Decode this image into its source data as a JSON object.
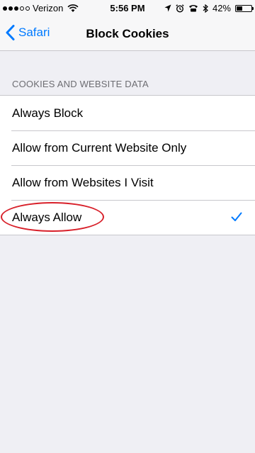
{
  "status_bar": {
    "signal_bars_filled": 3,
    "signal_bars_total": 5,
    "carrier": "Verizon",
    "time": "5:56 PM",
    "battery_percent": "42%",
    "battery_level": 0.42,
    "icons": [
      "wifi-icon",
      "location-arrow-icon",
      "alarm-icon",
      "phone-icon",
      "bluetooth-icon",
      "battery-icon"
    ]
  },
  "nav": {
    "back_label": "Safari",
    "title": "Block Cookies",
    "accent_color": "#007aff"
  },
  "section": {
    "header": "COOKIES AND WEBSITE DATA",
    "options": [
      {
        "label": "Always Block",
        "selected": false
      },
      {
        "label": "Allow from Current Website Only",
        "selected": false
      },
      {
        "label": "Allow from Websites I Visit",
        "selected": false
      },
      {
        "label": "Always Allow",
        "selected": true,
        "annotated": true
      }
    ]
  },
  "annotation": {
    "shape": "ellipse",
    "color": "#d8202a",
    "target": "Always Allow"
  }
}
